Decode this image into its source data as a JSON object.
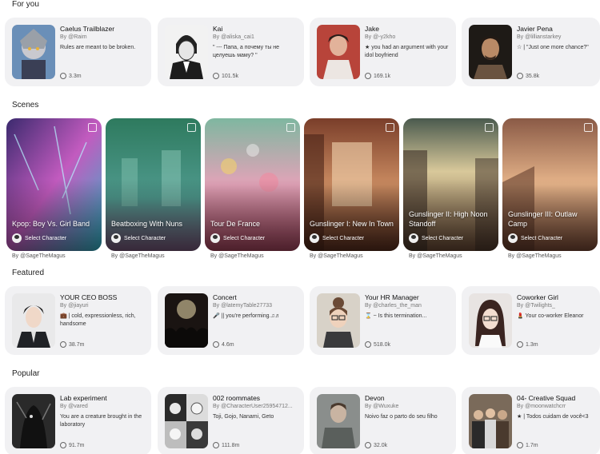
{
  "sections": {
    "for_you": "For you",
    "scenes": "Scenes",
    "featured": "Featured",
    "popular": "Popular"
  },
  "for_you": [
    {
      "name": "Caelus Trailblazer",
      "by": "By @Raim",
      "desc": "Rules are meant to be broken.",
      "count": "3.3m"
    },
    {
      "name": "Kai",
      "by": "By @aliska_cai1",
      "desc": "\" --- Папа, а почему ты не целуешь маму? \"",
      "count": "101.5k"
    },
    {
      "name": "Jake",
      "by": "By @-y2kho",
      "desc": "★ you had an argument with your idol boyfriend",
      "count": "169.1k"
    },
    {
      "name": "Javier Pena",
      "by": "By @lillianstarkey",
      "desc": "☆ | \"Just one more chance?\"",
      "count": "35.8k"
    }
  ],
  "scenes": [
    {
      "title": "Kpop: Boy Vs. Girl Band",
      "select": "Select Character",
      "by": "By @SageTheMagus"
    },
    {
      "title": "Beatboxing With Nuns",
      "select": "Select Character",
      "by": "By @SageTheMagus"
    },
    {
      "title": "Tour De France",
      "select": "Select Character",
      "by": "By @SageTheMagus"
    },
    {
      "title": "Gunslinger I: New In Town",
      "select": "Select Character",
      "by": "By @SageTheMagus"
    },
    {
      "title": "Gunslinger II: High Noon Standoff",
      "select": "Select Character",
      "by": "By @SageTheMagus"
    },
    {
      "title": "Gunslinger III: Outlaw Camp",
      "select": "Select Character",
      "by": "By @SageTheMagus"
    }
  ],
  "featured": [
    {
      "name": "YOUR CEO BOSS",
      "by": "By @jiayuri",
      "desc": "💼 | cold, expressionless, rich, handsome",
      "count": "38.7m"
    },
    {
      "name": "Concert",
      "by": "By @latemyTable27733",
      "desc": "🎤 || you're performing.♫♬",
      "count": "4.6m"
    },
    {
      "name": "Your HR Manager",
      "by": "By @charles_the_man",
      "desc": "⌛ ~ Is this termination...",
      "count": "518.0k"
    },
    {
      "name": "Coworker Girl",
      "by": "By @Twilights_",
      "desc": "💄 Your co-worker Eleanor",
      "count": "1.3m"
    }
  ],
  "popular": [
    {
      "name": "Lab experiment",
      "by": "By @vared",
      "desc": "You are a creature brought in the laboratory",
      "count": "91.7m"
    },
    {
      "name": "002 roommates",
      "by": "By @CharacterUser25954712...",
      "desc": "Toji, Gojo, Nanami, Geto",
      "count": "111.8m"
    },
    {
      "name": "Devon",
      "by": "By @Wuxuke",
      "desc": "Noivo faz o parto do seu filho",
      "count": "32.0k"
    },
    {
      "name": "04- Creative Squad",
      "by": "By @moonwatchcrr",
      "desc": "★ | Todos cuidam de você<3",
      "count": "1.7m"
    }
  ],
  "icons": {
    "chat": "chat-bubble-icon",
    "image": "image-icon",
    "avatar": "avatar-icon"
  }
}
